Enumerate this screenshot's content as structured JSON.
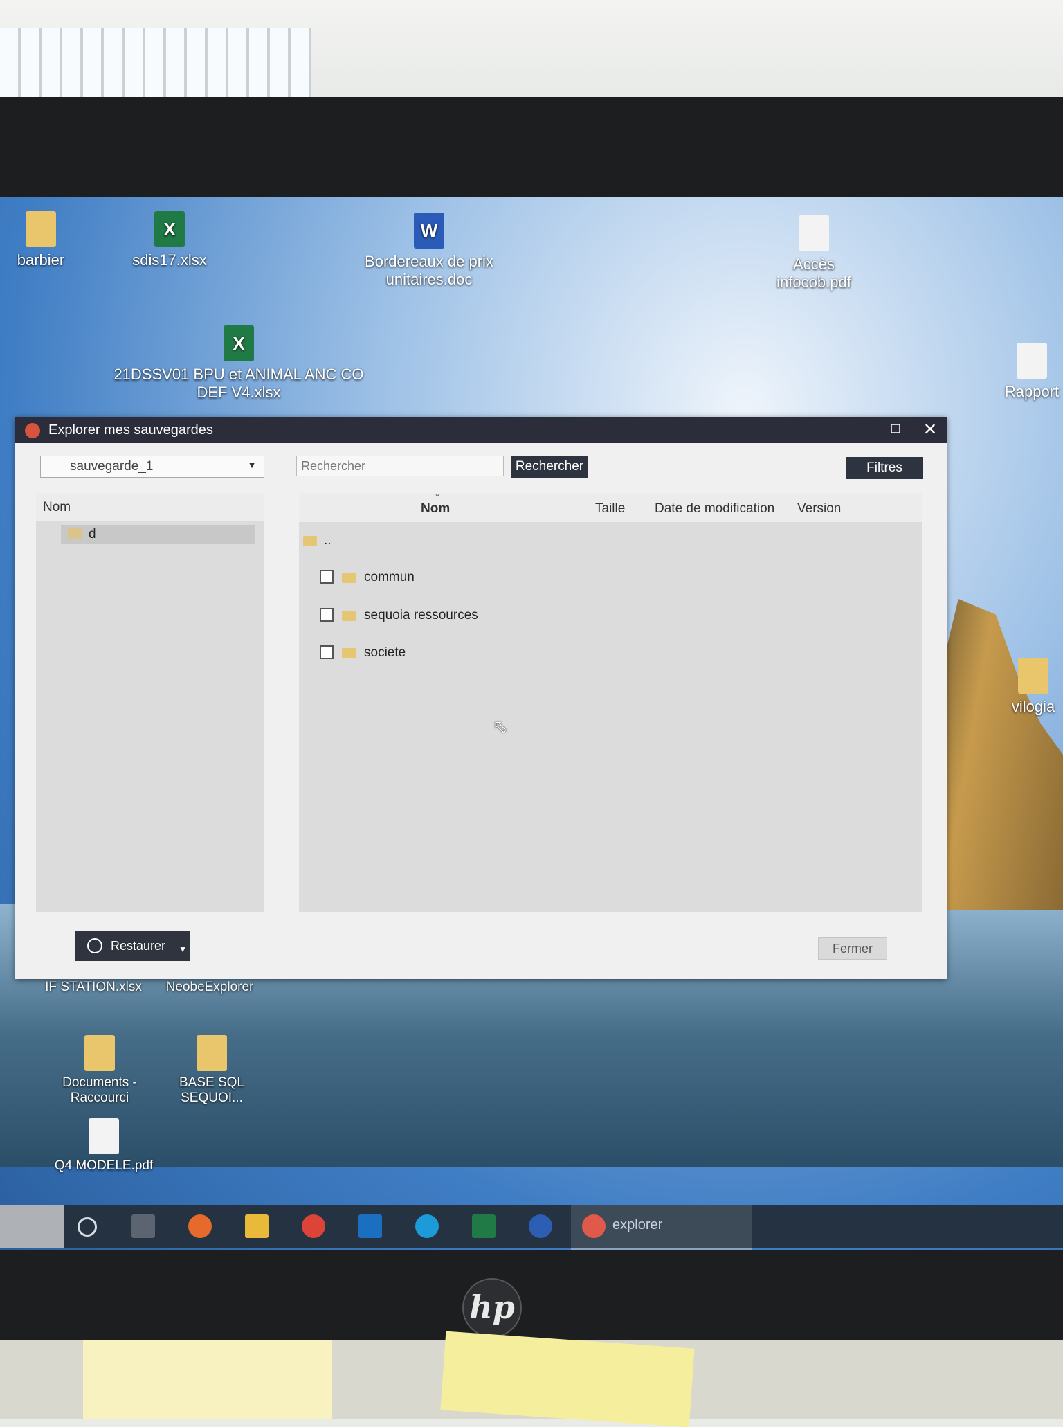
{
  "desktop": {
    "icons": [
      {
        "id": "barbier",
        "label": "barbier",
        "type": "folder"
      },
      {
        "id": "sdis17",
        "label": "sdis17.xlsx",
        "type": "excel"
      },
      {
        "id": "bordereaux",
        "label": "Bordereaux de prix unitaires.doc",
        "type": "word"
      },
      {
        "id": "acces",
        "label": "Accès infocob.pdf",
        "type": "pdf"
      },
      {
        "id": "bpu",
        "label": "21DSSV01 BPU et ANIMAL ANC CO DEF V4.xlsx",
        "type": "excel"
      },
      {
        "id": "rapport",
        "label": "Rapport",
        "type": "pdf"
      },
      {
        "id": "vilogia",
        "label": "vilogia",
        "type": "folder"
      },
      {
        "id": "station",
        "label": "IF STATION.xlsx",
        "type": "excel"
      },
      {
        "id": "neobe",
        "label": "NeobeExplorer",
        "type": "app"
      },
      {
        "id": "documents",
        "label": "Documents - Raccourci",
        "type": "folder"
      },
      {
        "id": "basesql",
        "label": "BASE SQL SEQUOI...",
        "type": "folder"
      },
      {
        "id": "q4",
        "label": "Q4 MODELE.pdf",
        "type": "pdf"
      }
    ]
  },
  "dialog": {
    "title": "Explorer mes sauvegardes",
    "backup_select": "sauvegarde_1",
    "search_placeholder": "Rechercher",
    "search_button": "Rechercher",
    "filters_button": "Filtres",
    "tree": {
      "header": "Nom",
      "nodes": [
        {
          "label": "d"
        }
      ]
    },
    "list": {
      "columns": [
        "Nom",
        "Taille",
        "Date de modification",
        "Version"
      ],
      "parent": "..",
      "rows": [
        {
          "name": "commun"
        },
        {
          "name": "sequoia ressources"
        },
        {
          "name": "societe"
        }
      ]
    },
    "restore_button": "Restaurer",
    "close_button": "Fermer"
  },
  "taskbar": {
    "active_app": "explorer"
  },
  "monitor": {
    "brand": "hp"
  },
  "colors": {
    "titlebar": "#2b2d3a",
    "button_dark": "#2e3340",
    "panel": "#dcdcdc",
    "folder": "#e5c673"
  }
}
